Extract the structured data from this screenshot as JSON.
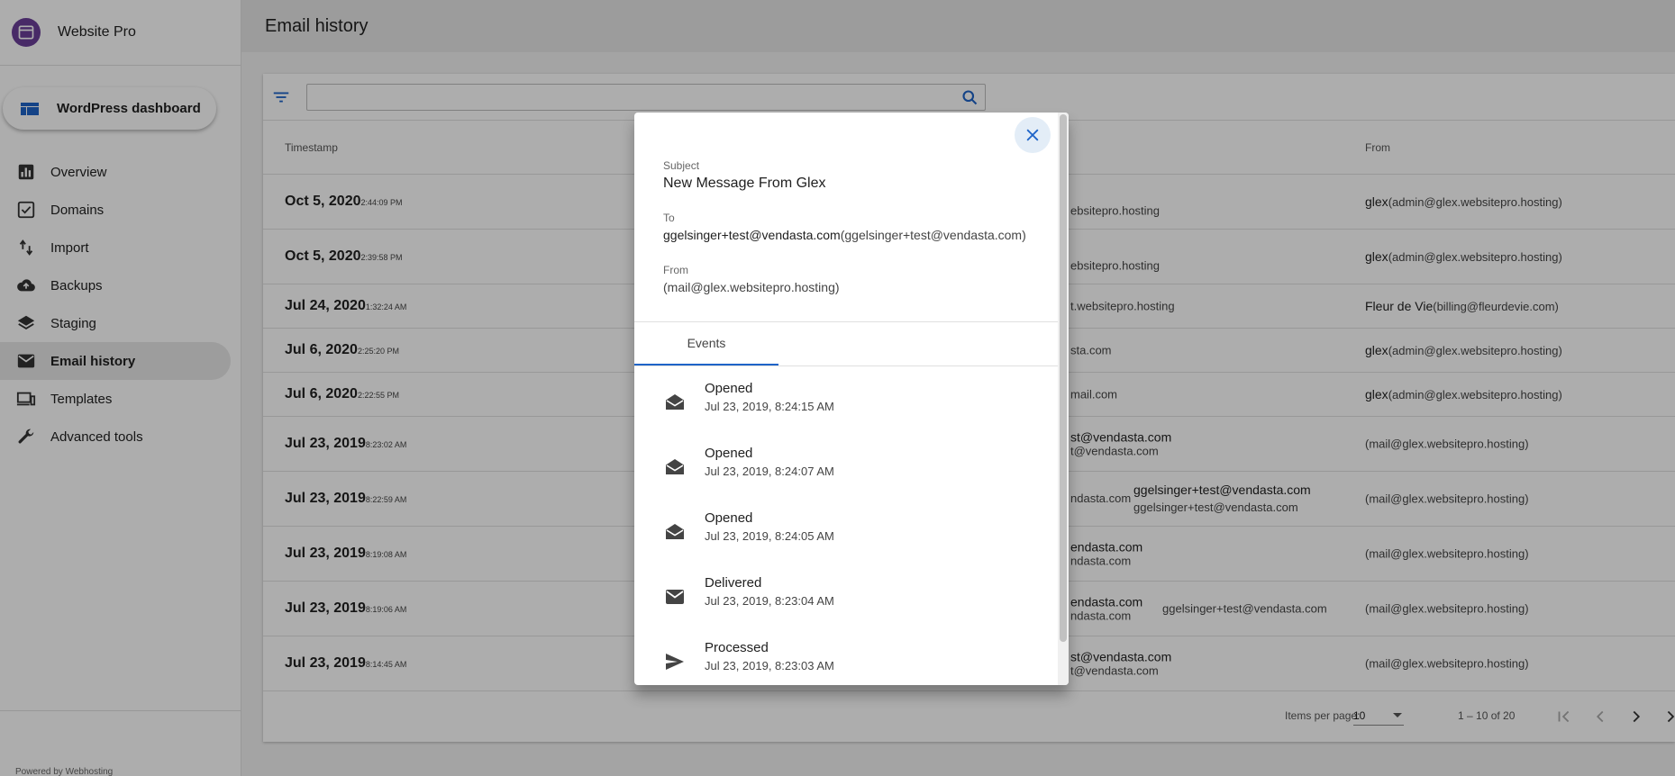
{
  "app": {
    "name": "Website Pro",
    "wordpress_button": "WordPress dashboard",
    "powered_by": "Powered by Webhosting"
  },
  "sidebar": {
    "items": [
      {
        "label": "Overview",
        "icon": "bar-chart-icon"
      },
      {
        "label": "Domains",
        "icon": "check-box-icon"
      },
      {
        "label": "Import",
        "icon": "import-arrows-icon"
      },
      {
        "label": "Backups",
        "icon": "cloud-upload-icon"
      },
      {
        "label": "Staging",
        "icon": "layers-icon"
      },
      {
        "label": "Email history",
        "icon": "mail-icon",
        "active": true
      },
      {
        "label": "Templates",
        "icon": "devices-icon"
      },
      {
        "label": "Advanced tools",
        "icon": "wrench-icon"
      }
    ]
  },
  "page": {
    "title": "Email history",
    "search_value": ""
  },
  "table": {
    "headers": {
      "timestamp": "Timestamp",
      "from": "From"
    },
    "rows": [
      {
        "date": "Oct 5, 2020",
        "time": "2:44:09 PM",
        "to_line1": "",
        "to_line2": "ebsitepro.hosting",
        "from_name": "glex",
        "from_email": "(admin@glex.websitepro.hosting)"
      },
      {
        "date": "Oct 5, 2020",
        "time": "2:39:58 PM",
        "to_line1": "",
        "to_line2": "ebsitepro.hosting",
        "from_name": "glex",
        "from_email": "(admin@glex.websitepro.hosting)"
      },
      {
        "date": "Jul 24, 2020",
        "time": "1:32:24 AM",
        "to_line1": "",
        "to_line2": "t.websitepro.hosting",
        "from_name": "Fleur de Vie",
        "from_email": "(billing@fleurdevie.com)"
      },
      {
        "date": "Jul 6, 2020",
        "time": "2:25:20 PM",
        "to_line1": "",
        "to_line2": "sta.com",
        "from_name": "glex",
        "from_email": "(admin@glex.websitepro.hosting)"
      },
      {
        "date": "Jul 6, 2020",
        "time": "2:22:55 PM",
        "to_line1": "",
        "to_line2": "mail.com",
        "from_name": "glex",
        "from_email": "(admin@glex.websitepro.hosting)"
      },
      {
        "date": "Jul 23, 2019",
        "time": "8:23:02 AM",
        "to_line1": "st@vendasta.com",
        "to_line2": "t@vendasta.com",
        "from_name": "",
        "from_email": "(mail@glex.websitepro.hosting)"
      },
      {
        "date": "Jul 23, 2019",
        "time": "8:22:59 AM",
        "to_line1": "ndasta.com",
        "to_extra1": "ggelsinger+test@vendasta.com",
        "to_extra2": "ggelsinger+test@vendasta.com",
        "to_line2": "",
        "from_name": "",
        "from_email": "(mail@glex.websitepro.hosting)"
      },
      {
        "date": "Jul 23, 2019",
        "time": "8:19:08 AM",
        "to_line1": "endasta.com",
        "to_line2": "ndasta.com",
        "from_name": "",
        "from_email": "(mail@glex.websitepro.hosting)"
      },
      {
        "date": "Jul 23, 2019",
        "time": "8:19:06 AM",
        "to_line1": "endasta.com",
        "to_extra1": "ggelsinger+test@vendasta.com",
        "to_line2": "ndasta.com",
        "from_name": "",
        "from_email": "(mail@glex.websitepro.hosting)"
      },
      {
        "date": "Jul 23, 2019",
        "time": "8:14:45 AM",
        "to_line1": "st@vendasta.com",
        "to_line2": "t@vendasta.com",
        "from_name": "",
        "from_email": "(mail@glex.websitepro.hosting)"
      }
    ]
  },
  "paginator": {
    "items_per_page_label": "Items per page:",
    "items_per_page": "10",
    "range": "1 – 10 of 20"
  },
  "dialog": {
    "subject_label": "Subject",
    "subject": "New Message From Glex",
    "to_label": "To",
    "to_name": "ggelsinger+test@vendasta.com",
    "to_email": "(ggelsinger+test@vendasta.com)",
    "from_label": "From",
    "from_email": "(mail@glex.websitepro.hosting)",
    "tab_events": "Events",
    "events": [
      {
        "title": "Opened",
        "time": "Jul 23, 2019, 8:24:15 AM",
        "icon": "drafts-icon"
      },
      {
        "title": "Opened",
        "time": "Jul 23, 2019, 8:24:07 AM",
        "icon": "drafts-icon"
      },
      {
        "title": "Opened",
        "time": "Jul 23, 2019, 8:24:05 AM",
        "icon": "drafts-icon"
      },
      {
        "title": "Delivered",
        "time": "Jul 23, 2019, 8:23:04 AM",
        "icon": "mail-icon"
      },
      {
        "title": "Processed",
        "time": "Jul 23, 2019, 8:23:03 AM",
        "icon": "send-icon"
      }
    ]
  },
  "colors": {
    "brand": "#6a3f99",
    "accent": "#1e64c8",
    "icon": "#333333"
  }
}
